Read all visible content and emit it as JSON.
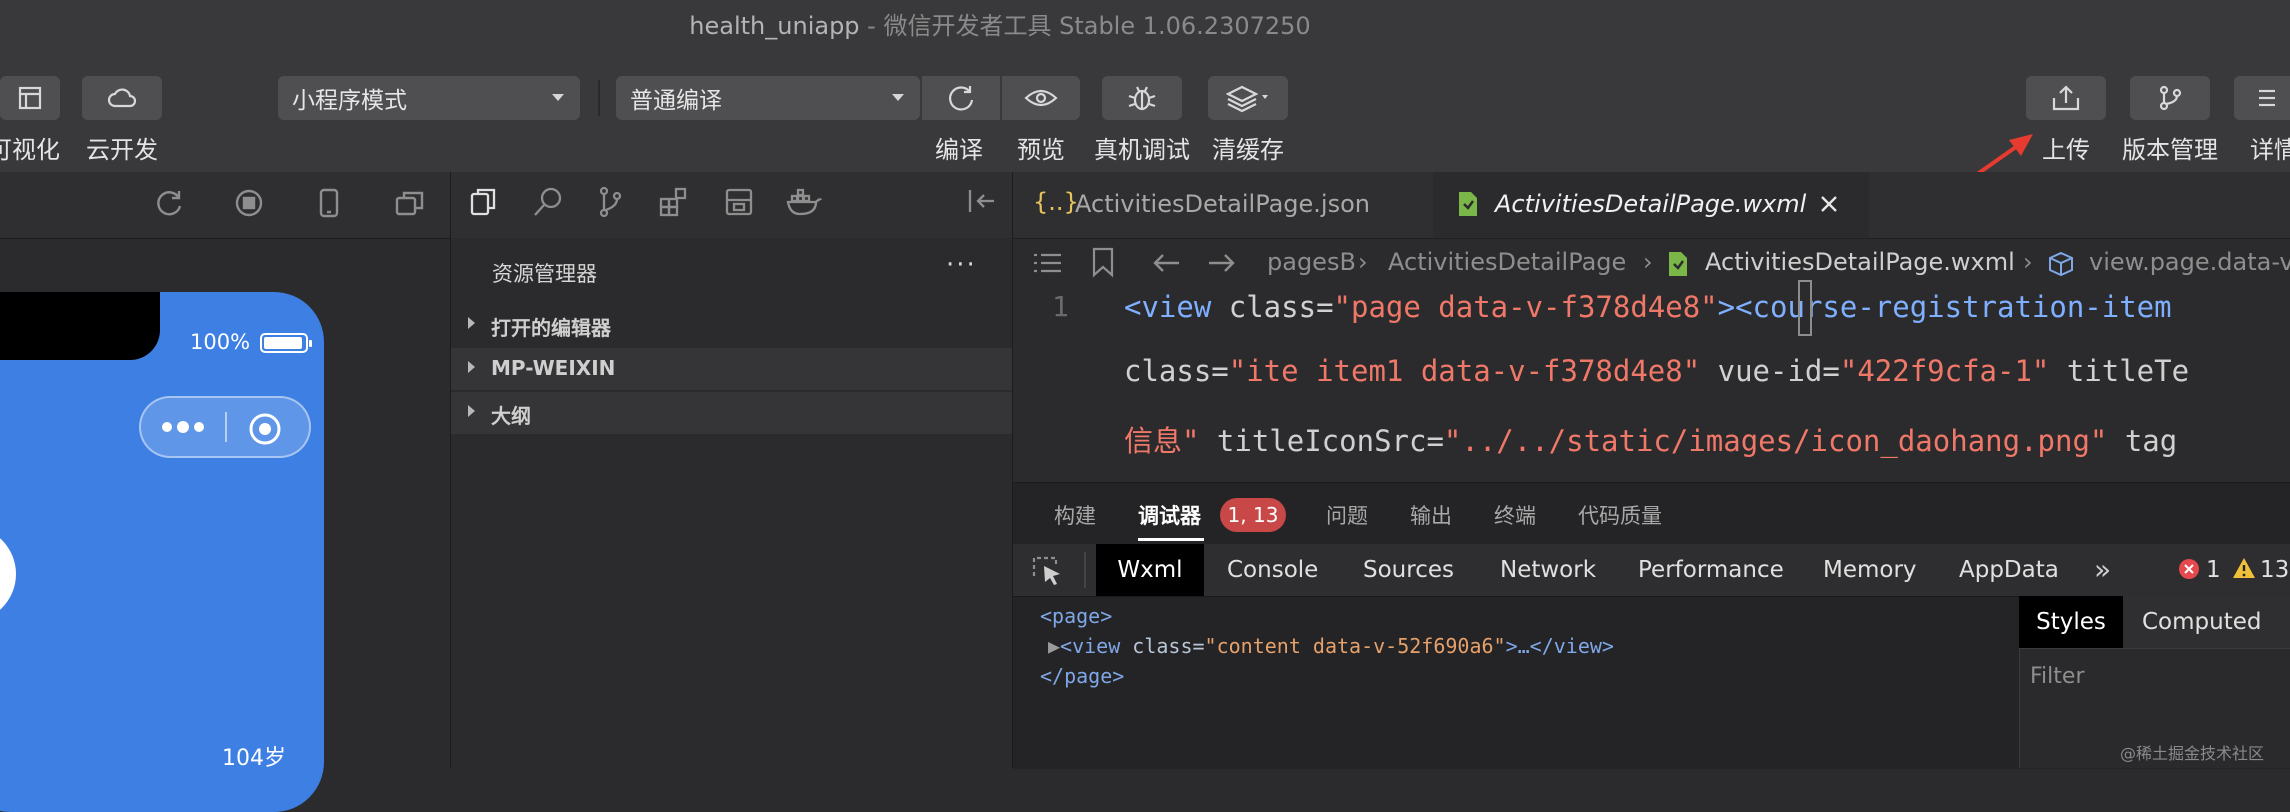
{
  "window": {
    "title_project": "health_uniapp",
    "title_app": " - 微信开发者工具 Stable 1.06.2307250"
  },
  "toolbar": {
    "visual_label": "可视化",
    "cloud_label": "云开发",
    "mode_select": "小程序模式",
    "compile_select": "普通编译",
    "compile_label": "编译",
    "preview_label": "预览",
    "debug_label": "真机调试",
    "cache_label": "清缓存",
    "upload_label": "上传",
    "version_label": "版本管理",
    "detail_label": "详情"
  },
  "simulator": {
    "battery": "100%",
    "age": "104岁",
    "accent_color": "#3d7fe3"
  },
  "explorer": {
    "title": "资源管理器",
    "more": "···",
    "tree": [
      {
        "label": "打开的编辑器"
      },
      {
        "label": "MP-WEIXIN"
      },
      {
        "label": "大纲"
      }
    ]
  },
  "editor": {
    "tabs": [
      {
        "label": "ActivitiesDetailPage.json",
        "icon": "{..}"
      },
      {
        "label": "ActivitiesDetailPage.wxml",
        "icon": "file-icon"
      }
    ],
    "breadcrumb": {
      "part1": "pagesB",
      "part2": "ActivitiesDetailPage",
      "part3": "ActivitiesDetailPage.wxml",
      "part4": "view.page.data-v"
    },
    "line_number": "1",
    "code": {
      "l1_tag_open": "<view ",
      "l1_attr": "class=",
      "l1_str": "\"page data-v-f378d4e8\"",
      "l1_tag2": "><course-registration-item",
      "l2_attr": "class=",
      "l2_str": "\"ite item1 data-v-f378d4e8\"",
      "l2_attr2": " vue-id=",
      "l2_str2": "\"422f9cfa-1\"",
      "l2_attr3": " titleTe",
      "l3_str_pre": "信息\"",
      "l3_attr": " titleIconSrc=",
      "l3_str": "\"../../static/images/icon_daohang.png\"",
      "l3_attr2": " tag"
    }
  },
  "panel": {
    "tabs": [
      "构建",
      "调试器",
      "问题",
      "输出",
      "终端",
      "代码质量"
    ],
    "badge": "1, 13",
    "devtools_tabs": [
      "Wxml",
      "Console",
      "Sources",
      "Network",
      "Performance",
      "Memory",
      "AppData"
    ],
    "more": "»",
    "errors": "1",
    "warnings": "13",
    "dom": {
      "line1": "<page>",
      "line2_tag": "<view ",
      "line2_attr": "class=",
      "line2_val": "\"content data-v-52f690a6\"",
      "line2_close": ">…</view>",
      "line3": "</page>"
    },
    "styles_tab": "Styles",
    "computed_tab": "Computed",
    "filter_placeholder": "Filter"
  },
  "watermark": "@稀土掘金技术社区"
}
